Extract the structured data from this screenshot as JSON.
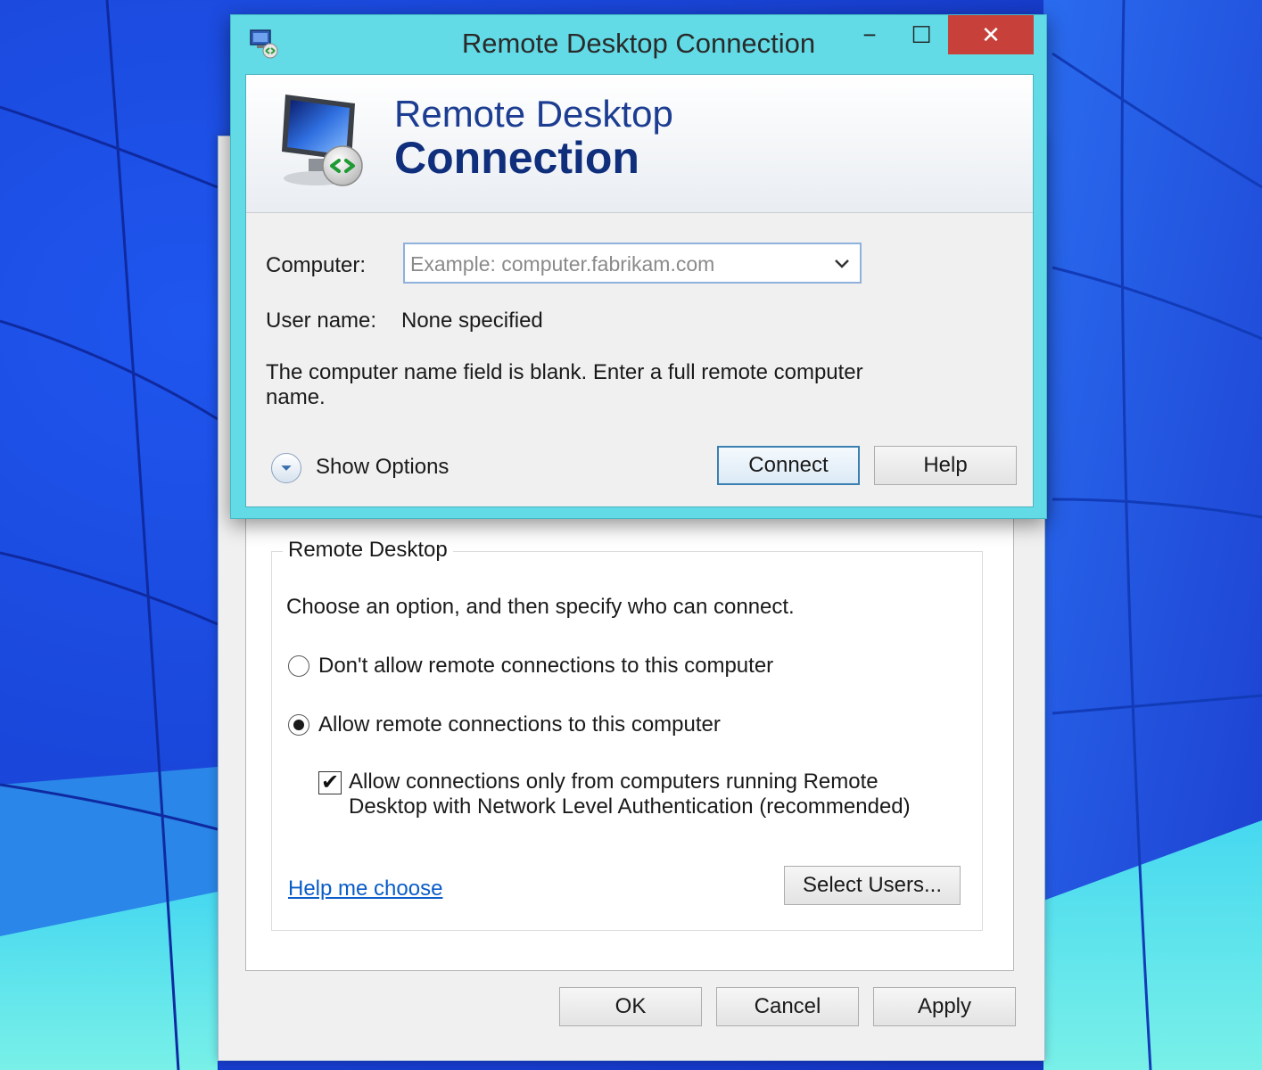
{
  "rdc": {
    "title": "Remote Desktop Connection",
    "window_controls": {
      "minimize": "−",
      "maximize": "☐",
      "close": "✕"
    },
    "banner": {
      "line1": "Remote Desktop",
      "line2": "Connection"
    },
    "computer_label": "Computer:",
    "computer_value": "",
    "computer_placeholder": "Example: computer.fabrikam.com",
    "username_label": "User name:",
    "username_value": "None specified",
    "message_line1": "The computer name field is blank. Enter a full remote computer",
    "message_line2": "name.",
    "show_options": "Show Options",
    "connect": "Connect",
    "help": "Help"
  },
  "sysprops": {
    "group_title": "Remote Desktop",
    "instruction": "Choose an option, and then specify who can connect.",
    "option_dont_allow": "Don't allow remote connections to this computer",
    "option_allow": "Allow remote connections to this computer",
    "selected_option": "allow",
    "nla_line1": "Allow connections only from computers running Remote",
    "nla_line2": "Desktop with Network Level Authentication (recommended)",
    "nla_checked": true,
    "nla_check_mark": "✔",
    "help_me_choose": "Help me choose",
    "select_users": "Select Users...",
    "ok": "OK",
    "cancel": "Cancel",
    "apply": "Apply"
  },
  "colors": {
    "titlebar": "#62dbe6",
    "close_button": "#c7413a",
    "banner_text": "#1c3d91",
    "link": "#0a5cc8",
    "desktop_blue": "#1a3fd6",
    "desktop_cyan": "#3fe0ec"
  }
}
